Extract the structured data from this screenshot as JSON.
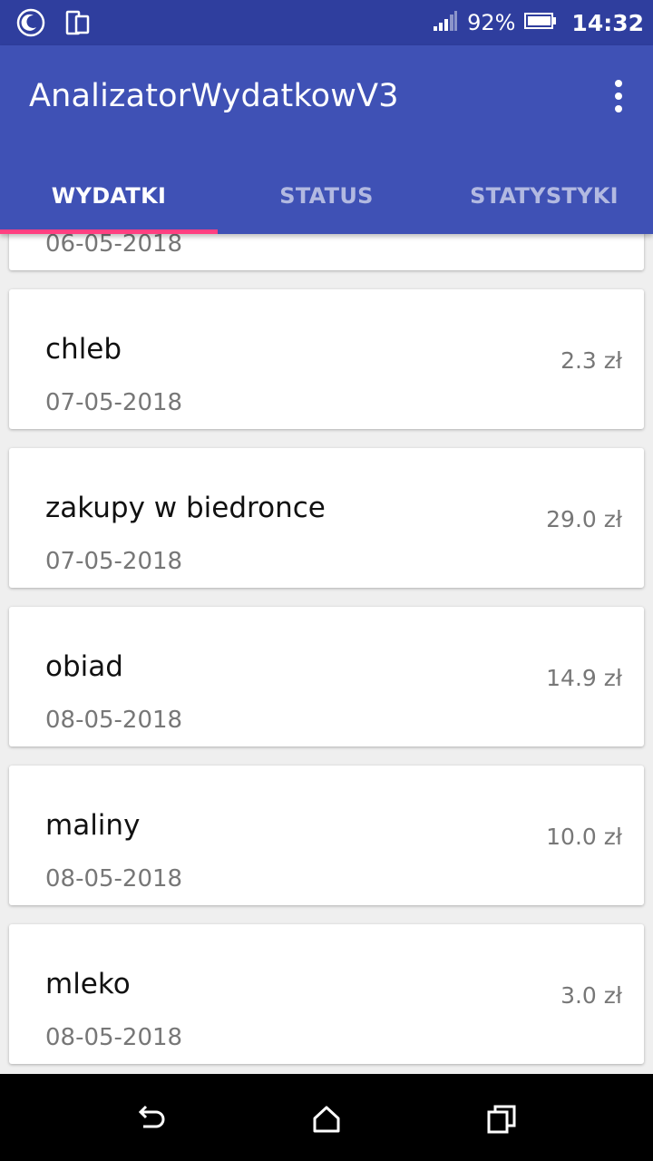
{
  "status_bar": {
    "battery": "92%",
    "time": "14:32"
  },
  "app_bar": {
    "title": "AnalizatorWydatkowV3"
  },
  "tabs": [
    {
      "label": "WYDATKI",
      "active": true
    },
    {
      "label": "STATUS",
      "active": false
    },
    {
      "label": "STATYSTYKI",
      "active": false
    }
  ],
  "expenses": [
    {
      "name": "",
      "date": "06-05-2018",
      "amount": ""
    },
    {
      "name": "chleb",
      "date": "07-05-2018",
      "amount": "2.3 zł"
    },
    {
      "name": "zakupy w biedronce",
      "date": "07-05-2018",
      "amount": "29.0 zł"
    },
    {
      "name": "obiad",
      "date": "08-05-2018",
      "amount": "14.9 zł"
    },
    {
      "name": "maliny",
      "date": "08-05-2018",
      "amount": "10.0 zł"
    },
    {
      "name": "mleko",
      "date": "08-05-2018",
      "amount": "3.0 zł"
    }
  ],
  "colors": {
    "status_bar": "#2f3e9e",
    "primary": "#3f51b5",
    "accent": "#ff4081"
  },
  "icons": {
    "status_left": [
      "moon-icon",
      "phone-sync-icon"
    ],
    "status_right": [
      "signal-icon",
      "battery-icon"
    ],
    "nav": [
      "back-icon",
      "home-icon",
      "recents-icon"
    ]
  }
}
